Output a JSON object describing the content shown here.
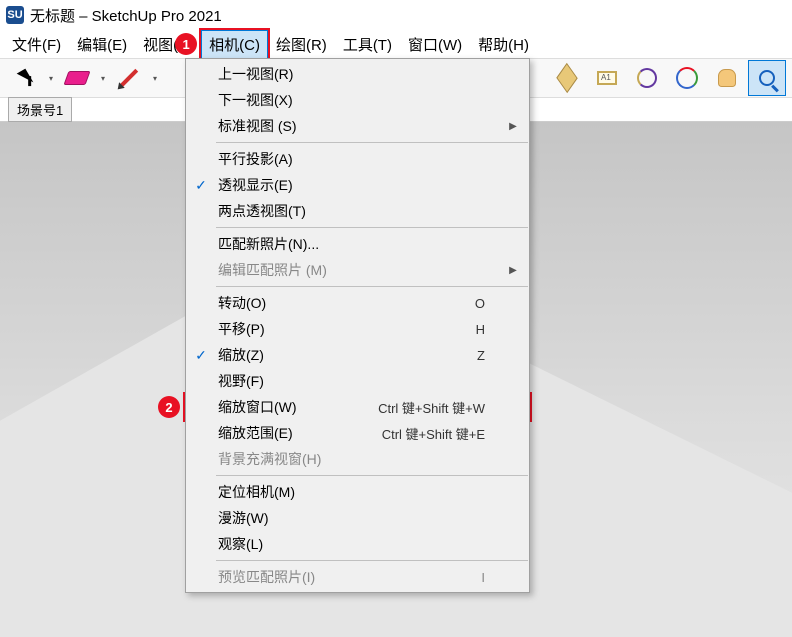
{
  "title": "无标题 – SketchUp Pro 2021",
  "app_icon_text": "SU",
  "menubar": {
    "items": [
      {
        "label": "文件(F)"
      },
      {
        "label": "编辑(E)"
      },
      {
        "label": "视图(V)"
      },
      {
        "label": "相机(C)"
      },
      {
        "label": "绘图(R)"
      },
      {
        "label": "工具(T)"
      },
      {
        "label": "窗口(W)"
      },
      {
        "label": "帮助(H)"
      }
    ],
    "active_index": 3
  },
  "annotations": {
    "badge1": "1",
    "badge2": "2"
  },
  "scene_bar": {
    "label": "场景号1"
  },
  "dropdown": {
    "groups": [
      [
        {
          "label": "上一视图(R)",
          "shortcut": "",
          "checked": false,
          "enabled": true,
          "submenu": false
        },
        {
          "label": "下一视图(X)",
          "shortcut": "",
          "checked": false,
          "enabled": true,
          "submenu": false
        },
        {
          "label": "标准视图 (S)",
          "shortcut": "",
          "checked": false,
          "enabled": true,
          "submenu": true
        }
      ],
      [
        {
          "label": "平行投影(A)",
          "shortcut": "",
          "checked": false,
          "enabled": true,
          "submenu": false
        },
        {
          "label": "透视显示(E)",
          "shortcut": "",
          "checked": true,
          "enabled": true,
          "submenu": false
        },
        {
          "label": "两点透视图(T)",
          "shortcut": "",
          "checked": false,
          "enabled": true,
          "submenu": false
        }
      ],
      [
        {
          "label": "匹配新照片(N)...",
          "shortcut": "",
          "checked": false,
          "enabled": true,
          "submenu": false
        },
        {
          "label": "编辑匹配照片 (M)",
          "shortcut": "",
          "checked": false,
          "enabled": false,
          "submenu": true
        }
      ],
      [
        {
          "label": "转动(O)",
          "shortcut": "O",
          "checked": false,
          "enabled": true,
          "submenu": false
        },
        {
          "label": "平移(P)",
          "shortcut": "H",
          "checked": false,
          "enabled": true,
          "submenu": false
        },
        {
          "label": "缩放(Z)",
          "shortcut": "Z",
          "checked": true,
          "enabled": true,
          "submenu": false
        },
        {
          "label": "视野(F)",
          "shortcut": "",
          "checked": false,
          "enabled": true,
          "submenu": false
        },
        {
          "label": "缩放窗口(W)",
          "shortcut": "Ctrl 键+Shift 键+W",
          "checked": false,
          "enabled": true,
          "submenu": false
        },
        {
          "label": "缩放范围(E)",
          "shortcut": "Ctrl 键+Shift 键+E",
          "checked": false,
          "enabled": true,
          "submenu": false
        },
        {
          "label": "背景充满视窗(H)",
          "shortcut": "",
          "checked": false,
          "enabled": false,
          "submenu": false
        }
      ],
      [
        {
          "label": "定位相机(M)",
          "shortcut": "",
          "checked": false,
          "enabled": true,
          "submenu": false
        },
        {
          "label": "漫游(W)",
          "shortcut": "",
          "checked": false,
          "enabled": true,
          "submenu": false
        },
        {
          "label": "观察(L)",
          "shortcut": "",
          "checked": false,
          "enabled": true,
          "submenu": false
        }
      ],
      [
        {
          "label": "预览匹配照片(I)",
          "shortcut": "I",
          "checked": false,
          "enabled": false,
          "submenu": false
        }
      ]
    ],
    "highlight_item": {
      "group": 3,
      "index": 4
    }
  }
}
